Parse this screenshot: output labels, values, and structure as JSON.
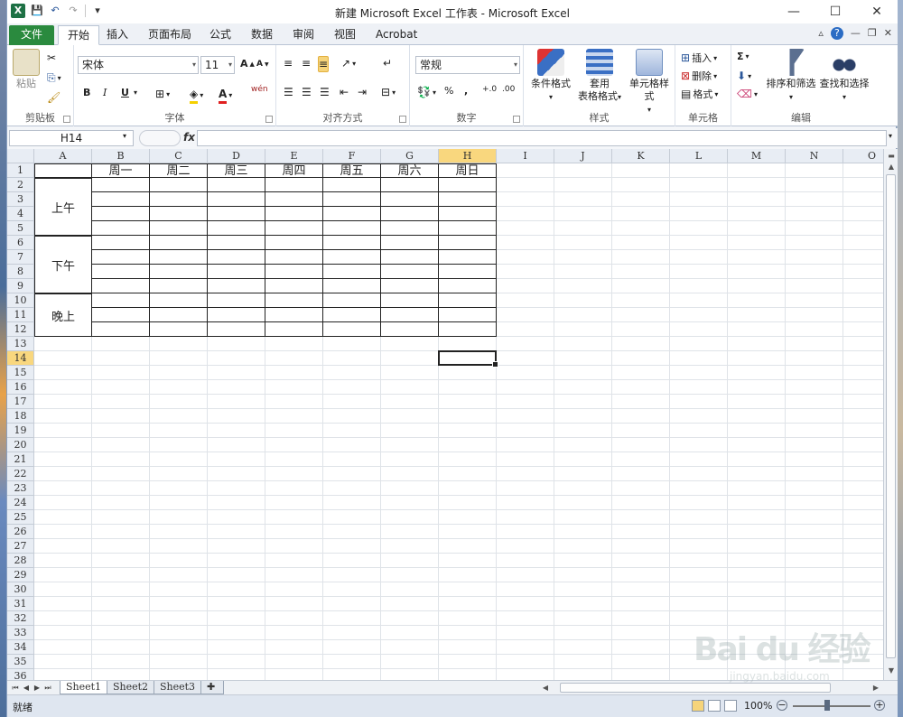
{
  "window": {
    "title": "新建 Microsoft Excel 工作表 - Microsoft Excel",
    "minimize": "—",
    "restore": "☐",
    "close": "✕"
  },
  "ribbon_tabs": [
    "文件",
    "开始",
    "插入",
    "页面布局",
    "公式",
    "数据",
    "审阅",
    "视图",
    "Acrobat"
  ],
  "ribbon": {
    "clipboard": {
      "label": "剪贴板",
      "paste": "粘贴"
    },
    "font": {
      "label": "字体",
      "font_name": "宋体",
      "font_size": "11",
      "bold": "B",
      "italic": "I",
      "underline": "U",
      "wen": "wén"
    },
    "alignment": {
      "label": "对齐方式"
    },
    "number": {
      "label": "数字",
      "format": "常规",
      "percent": "%",
      "comma": ",",
      "inc": "+.0",
      "dec": ".00"
    },
    "styles": {
      "label": "样式",
      "cond_format": "条件格式",
      "table_format_1": "套用",
      "table_format_2": "表格格式",
      "cell_style": "单元格样式"
    },
    "cells": {
      "label": "单元格",
      "insert": "插入",
      "delete": "删除",
      "format": "格式"
    },
    "editing": {
      "label": "编辑",
      "sigma": "Σ",
      "sort_filter": "排序和筛选",
      "find_select": "查找和选择"
    }
  },
  "formula_bar": {
    "name_box": "H14",
    "fx": "fx",
    "value": ""
  },
  "columns": [
    "A",
    "B",
    "C",
    "D",
    "E",
    "F",
    "G",
    "H",
    "I",
    "J",
    "K",
    "L",
    "M",
    "N",
    "O"
  ],
  "rows": [
    "1",
    "2",
    "3",
    "4",
    "5",
    "6",
    "7",
    "8",
    "9",
    "10",
    "11",
    "12",
    "13",
    "14",
    "15",
    "16",
    "17",
    "18",
    "19",
    "20",
    "21",
    "22",
    "23",
    "24",
    "25",
    "26",
    "27",
    "28",
    "29",
    "30",
    "31",
    "32",
    "33",
    "34",
    "35",
    "36"
  ],
  "selected_cell": {
    "col": "H",
    "row": "14"
  },
  "table": {
    "headers": [
      "周一",
      "周二",
      "周三",
      "周四",
      "周五",
      "周六",
      "周日"
    ],
    "periods": [
      "上午",
      "下午",
      "晚上"
    ]
  },
  "sheets": [
    "Sheet1",
    "Sheet2",
    "Sheet3"
  ],
  "active_sheet": "Sheet1",
  "status": {
    "text": "就绪",
    "zoom": "100%"
  },
  "watermark": {
    "brand": "Bai du 经验",
    "url": "jingyan.baidu.com"
  }
}
